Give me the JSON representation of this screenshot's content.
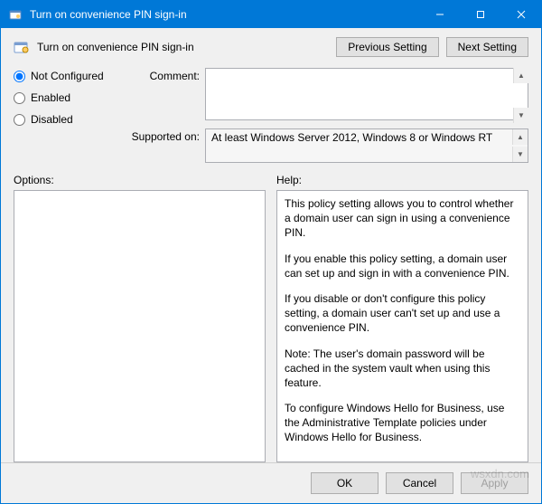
{
  "window": {
    "title": "Turn on convenience PIN sign-in"
  },
  "header": {
    "policy_title": "Turn on convenience PIN sign-in",
    "previous_setting": "Previous Setting",
    "next_setting": "Next Setting"
  },
  "state": {
    "not_configured": "Not Configured",
    "enabled": "Enabled",
    "disabled": "Disabled",
    "selected": "not_configured"
  },
  "labels": {
    "comment": "Comment:",
    "supported_on": "Supported on:",
    "options": "Options:",
    "help": "Help:"
  },
  "fields": {
    "comment_value": "",
    "supported_on_value": "At least Windows Server 2012, Windows 8 or Windows RT"
  },
  "help": {
    "p1": "This policy setting allows you to control whether a domain user can sign in using a convenience PIN.",
    "p2": "If you enable this policy setting, a domain user can set up and sign in with a convenience PIN.",
    "p3": "If you disable or don't configure this policy setting, a domain user can't set up and use a convenience PIN.",
    "p4": "Note: The user's domain password will be cached in the system vault when using this feature.",
    "p5": "To configure Windows Hello for Business, use the Administrative Template policies under Windows Hello for Business."
  },
  "footer": {
    "ok": "OK",
    "cancel": "Cancel",
    "apply": "Apply"
  },
  "watermark": "wsxdn.com"
}
